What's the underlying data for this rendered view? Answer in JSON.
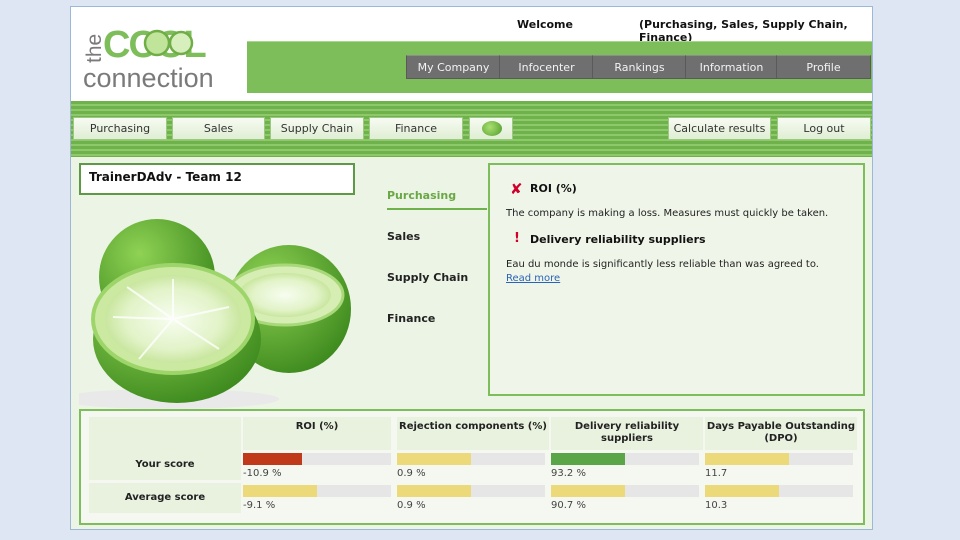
{
  "header": {
    "logo_text": {
      "word1": "the",
      "word2": "COOL",
      "word3": "connection"
    },
    "welcome": "Welcome",
    "roles": "(Purchasing, Sales, Supply Chain, Finance)",
    "top_nav": [
      "My Company",
      "Infocenter",
      "Rankings",
      "Information",
      "Profile"
    ]
  },
  "toolbar": {
    "areas": [
      "Purchasing",
      "Sales",
      "Supply Chain",
      "Finance"
    ],
    "calculate_label": "Calculate results",
    "logout_label": "Log out"
  },
  "team": "TrainerDAdv - Team 12",
  "areas_nav": [
    "Purchasing",
    "Sales",
    "Supply Chain",
    "Finance"
  ],
  "messages": [
    {
      "icon": "x-icon",
      "title": "ROI (%)",
      "text": "The company is making a loss. Measures must quickly be taken."
    },
    {
      "icon": "warning-icon",
      "title": "Delivery reliability suppliers",
      "text": "Eau du monde is significantly less reliable than was agreed to."
    }
  ],
  "read_more": "Read more",
  "scores": {
    "columns": [
      "ROI (%)",
      "Rejection components (%)",
      "Delivery reliability suppliers",
      "Days Payable Outstanding (DPO)"
    ],
    "rows": [
      {
        "label": "Your score",
        "values": [
          "-10.9 %",
          "0.9 %",
          "93.2 %",
          "11.7"
        ],
        "fill": [
          0.4,
          0.5,
          0.5,
          0.57
        ],
        "colors": [
          "#c0391b",
          "#ecd97a",
          "#5aa548",
          "#ecd97a"
        ]
      },
      {
        "label": "Average score",
        "values": [
          "-9.1 %",
          "0.9 %",
          "90.7 %",
          "10.3"
        ],
        "fill": [
          0.5,
          0.5,
          0.5,
          0.5
        ],
        "colors": [
          "#ecd97a",
          "#ecd97a",
          "#ecd97a",
          "#ecd97a"
        ]
      }
    ]
  },
  "colors": {
    "brand_green": "#7dbd5a",
    "nav_gray": "#6f6f6f",
    "alert_red": "#d0002a",
    "link_blue": "#2a63b8"
  }
}
